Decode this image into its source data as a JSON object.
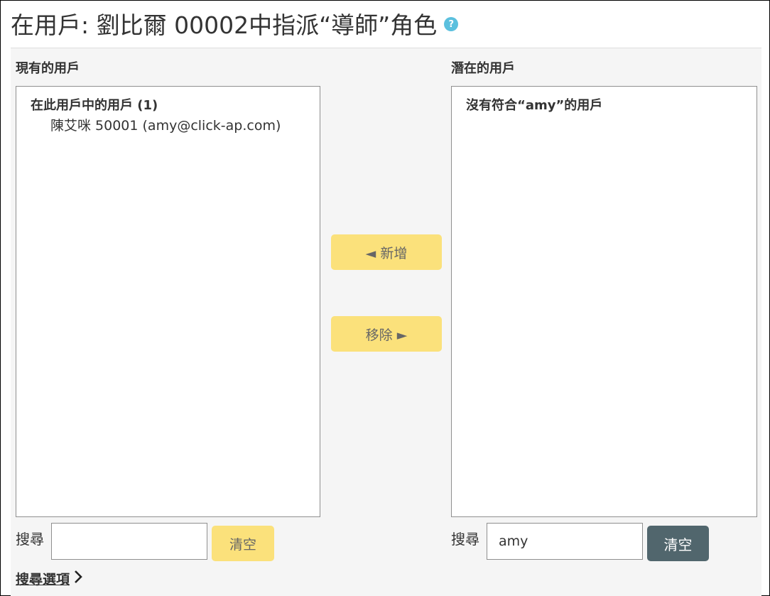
{
  "header": {
    "title": "在用戶: 劉比爾 00002中指派“導師”角色",
    "help_icon": "question-circle-icon"
  },
  "existing": {
    "heading": "現有的用戶",
    "group_label": "在此用戶中的用戶 (1)",
    "users": [
      "陳艾咪 50001 (amy@click-ap.com)"
    ],
    "search_label": "搜尋",
    "search_value": "",
    "clear_label": "清空"
  },
  "potential": {
    "heading": "潛在的用戶",
    "empty_message": "沒有符合“amy”的用戶",
    "search_label": "搜尋",
    "search_value": "amy",
    "clear_label": "清空"
  },
  "actions": {
    "add_label": "◄ 新增",
    "remove_label": "移除 ►"
  },
  "search_options": {
    "label": "搜尋選項"
  },
  "colors": {
    "accent_yellow": "#fbe17b",
    "clear_dark": "#51666d",
    "help_blue": "#5bc0de"
  }
}
